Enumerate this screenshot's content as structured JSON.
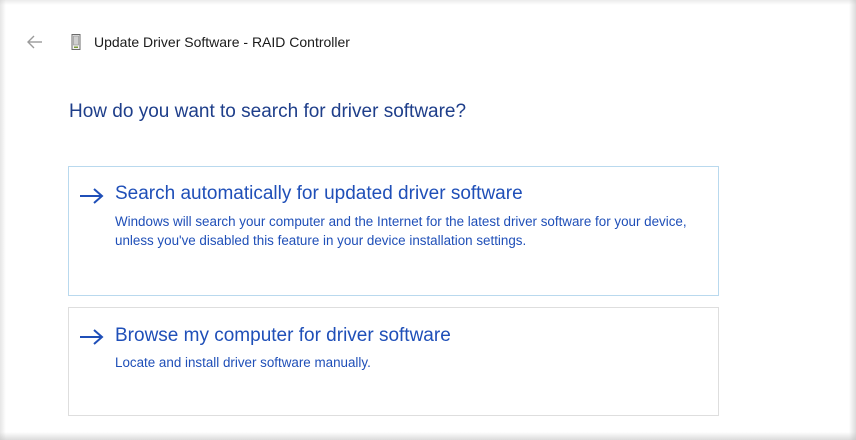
{
  "window": {
    "title": "Update Driver Software - RAID Controller",
    "back_icon": "back-arrow-icon",
    "device_icon": "device-icon"
  },
  "main": {
    "heading": "How do you want to search for driver software?",
    "options": [
      {
        "title": "Search automatically for updated driver software",
        "description": "Windows will search your computer and the Internet for the latest driver software for your device, unless you've disabled this feature in your device installation settings.",
        "icon": "right-arrow-icon"
      },
      {
        "title": "Browse my computer for driver software",
        "description": "Locate and install driver software manually.",
        "icon": "right-arrow-icon"
      }
    ]
  },
  "colors": {
    "heading": "#1e3e8a",
    "link": "#1f4fb8",
    "selected_border": "#b9d9ee",
    "border": "#dedede"
  }
}
